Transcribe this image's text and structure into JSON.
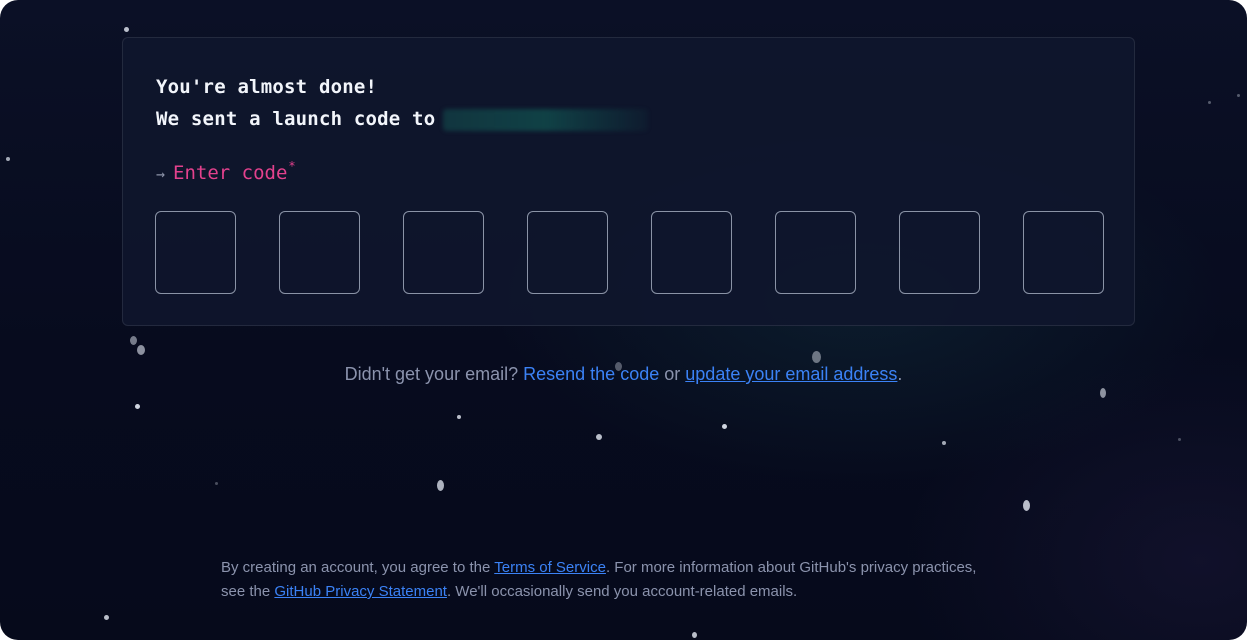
{
  "card": {
    "heading_line1": "You're almost done!",
    "heading_line2": "We sent a launch code to",
    "email_redacted": "",
    "code_label_arrow": "→",
    "code_label": "Enter code",
    "code_required_marker": "*",
    "code_digits": [
      "",
      "",
      "",
      "",
      "",
      "",
      "",
      ""
    ]
  },
  "resend": {
    "prefix": "Didn't get your email?",
    "resend_link": "Resend the code",
    "middle": "or",
    "update_link": "update your email address",
    "suffix": "."
  },
  "footer": {
    "text1": "By creating an account, you agree to the",
    "terms_link": "Terms of Service",
    "text2": ". For more information about GitHub's privacy practices,",
    "text3": "see the",
    "privacy_link": "GitHub Privacy Statement",
    "text4": ". We'll occasionally send you account-related emails."
  },
  "colors": {
    "background": "#070b1e",
    "accent_pink": "#e3418d",
    "link_blue": "#3b82f6",
    "muted_text": "#8b93ad"
  }
}
